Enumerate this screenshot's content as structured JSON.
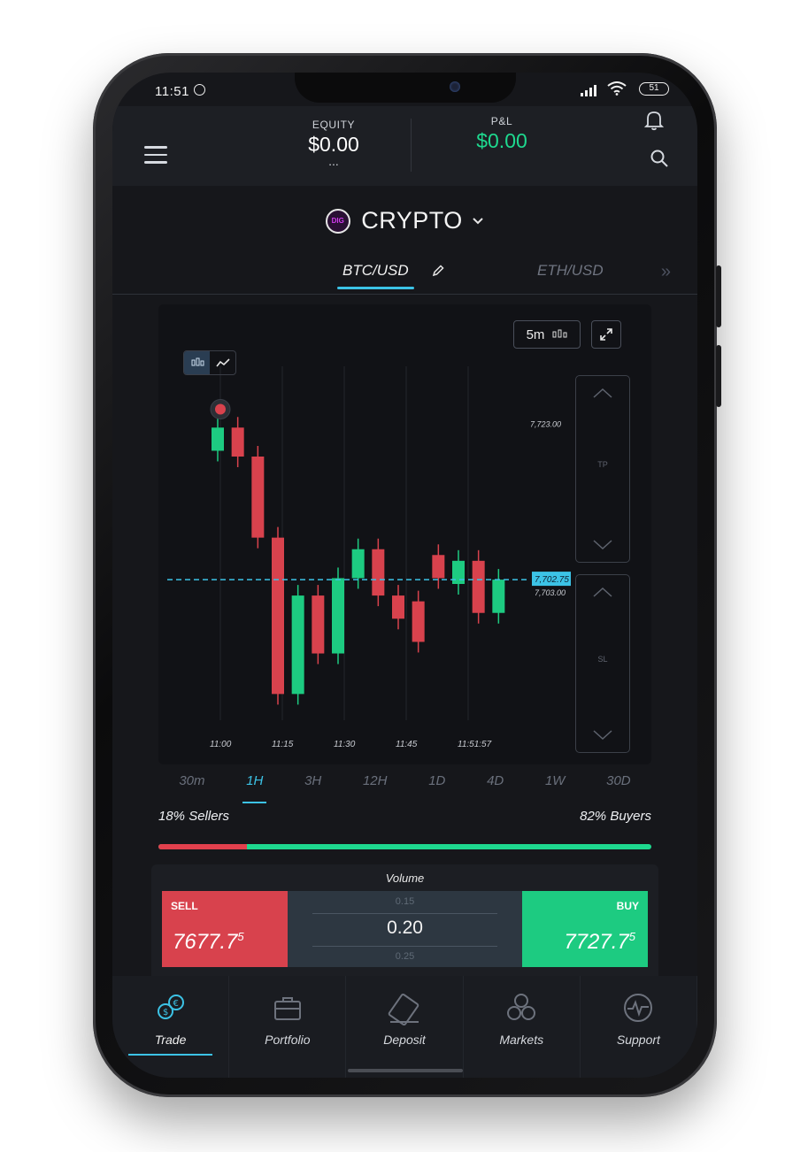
{
  "status_bar": {
    "time": "11:51",
    "battery": "51"
  },
  "header": {
    "equity_label": "EQUITY",
    "equity_value": "$0.00",
    "equity_dots": "...",
    "pnl_label": "P&L",
    "pnl_value": "$0.00"
  },
  "category": {
    "logo_text": "DIG",
    "label": "CRYPTO"
  },
  "pairs": [
    {
      "label": "BTC/USD",
      "active": true
    },
    {
      "label": "ETH/USD",
      "active": false
    }
  ],
  "chart": {
    "timeframe_label": "5m",
    "tp_label": "TP",
    "sl_label": "SL"
  },
  "chart_data": {
    "type": "candlestick",
    "x_tick_labels": [
      "11:00",
      "11:15",
      "11:30",
      "11:45",
      "11:51:57"
    ],
    "y_labels": [
      "7,723.00",
      "7,703.00"
    ],
    "current_price_label": "7,702.75",
    "candles": [
      {
        "open": 7725.0,
        "close": 7729.0
      },
      {
        "open": 7729.0,
        "close": 7724.0
      },
      {
        "open": 7724.0,
        "close": 7710.0
      },
      {
        "open": 7710.0,
        "close": 7683.0
      },
      {
        "open": 7683.0,
        "close": 7700.0
      },
      {
        "open": 7700.0,
        "close": 7690.0
      },
      {
        "open": 7690.0,
        "close": 7703.0
      },
      {
        "open": 7703.0,
        "close": 7708.0
      },
      {
        "open": 7708.0,
        "close": 7700.0
      },
      {
        "open": 7700.0,
        "close": 7696.0
      },
      {
        "open": 7699.0,
        "close": 7692.0
      },
      {
        "open": 7707.0,
        "close": 7703.0
      },
      {
        "open": 7702.0,
        "close": 7706.0
      },
      {
        "open": 7706.0,
        "close": 7697.0
      },
      {
        "open": 7697.0,
        "close": 7702.75
      }
    ],
    "current_price": 7702.75,
    "marker_price": 7723.0,
    "ylim": [
      7680,
      7735
    ],
    "colors": {
      "up": "#1dcb81",
      "down": "#d8424d",
      "price_line": "#3cc3e6"
    }
  },
  "periods": [
    "30m",
    "1H",
    "3H",
    "12H",
    "1D",
    "4D",
    "1W",
    "30D"
  ],
  "active_period": "1H",
  "sentiment": {
    "sellers_label": "18% Sellers",
    "buyers_label": "82% Buyers",
    "sellers_fraction": 0.18
  },
  "trade": {
    "volume_title": "Volume",
    "sell_label": "SELL",
    "sell_price_main": "7677.7",
    "sell_price_sup": "5",
    "buy_label": "BUY",
    "buy_price_main": "7727.7",
    "buy_price_sup": "5",
    "volume_prev": "0.15",
    "volume_current": "0.20",
    "volume_next": "0.25"
  },
  "nav": [
    {
      "label": "Trade",
      "icon": "trade-icon",
      "active": true
    },
    {
      "label": "Portfolio",
      "icon": "briefcase-icon",
      "active": false
    },
    {
      "label": "Deposit",
      "icon": "card-icon",
      "active": false
    },
    {
      "label": "Markets",
      "icon": "coins-icon",
      "active": false
    },
    {
      "label": "Support",
      "icon": "pulse-icon",
      "active": false
    }
  ],
  "colors": {
    "accent": "#3cc3e6",
    "buy": "#1dcb81",
    "sell": "#d8424d",
    "pnl": "#1ed98f"
  }
}
